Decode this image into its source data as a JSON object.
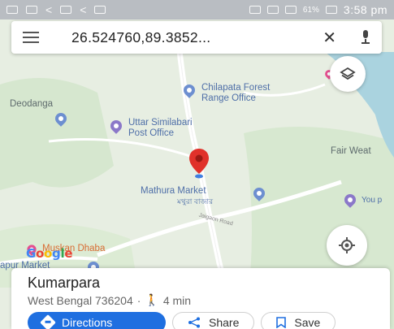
{
  "status_bar": {
    "battery_percent": "61%",
    "time": "3:58 pm"
  },
  "search": {
    "query": "26.524760,89.3852..."
  },
  "map": {
    "labels": {
      "deodanga": "Deodanga",
      "chilapata_line1": "Chilapata Forest",
      "chilapata_line2": "Range Office",
      "uttar_line1": "Uttar Similabari",
      "uttar_line2": "Post Office",
      "fair_weather": "Fair Weat",
      "mathura_market": "Mathura Market",
      "mathura_local": "মথুরা বাজার",
      "you_pass": "You p",
      "muskan_dhaba": "Muskan Dhaba",
      "google": "Google",
      "apur_market": "apur Market",
      "road": "Jaigaon Road"
    }
  },
  "place_card": {
    "name": "Kumarpara",
    "address": "West Bengal 736204",
    "separator": "·",
    "walk_time": "4 min",
    "actions": {
      "directions": "Directions",
      "share": "Share",
      "save": "Save"
    }
  },
  "colors": {
    "accent": "#1f6fe0",
    "marker": "#e0312a",
    "water": "#aad3df",
    "map_bg": "#e7eee2"
  },
  "icons": [
    "menu-icon",
    "close-icon",
    "mic-icon",
    "layers-icon",
    "my-location-icon",
    "location-pin-icon",
    "walk-icon",
    "directions-icon",
    "share-icon",
    "save-icon"
  ]
}
